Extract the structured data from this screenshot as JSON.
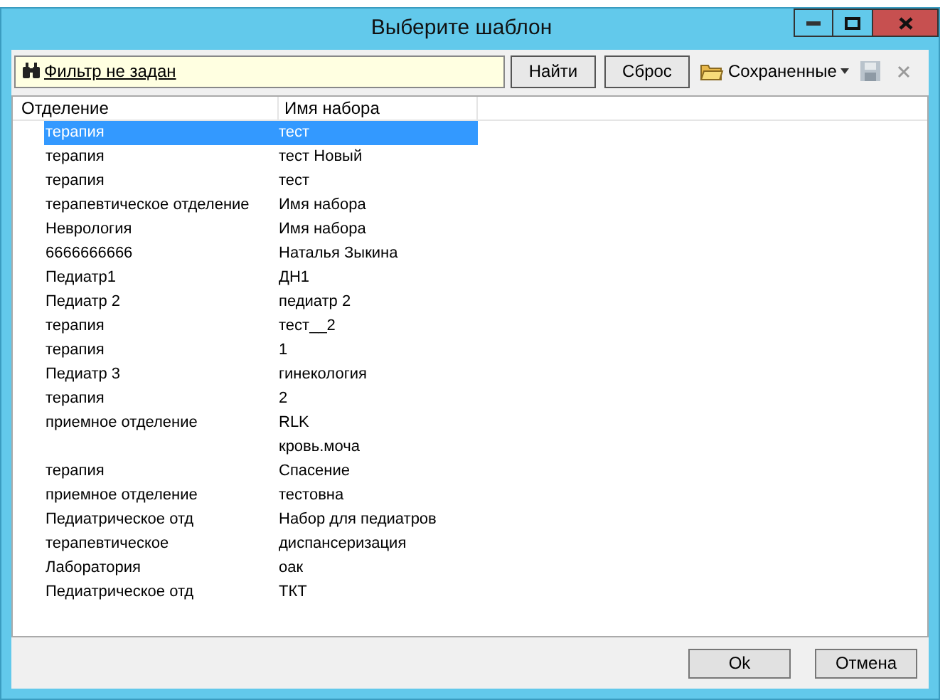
{
  "window": {
    "title": "Выберите шаблон"
  },
  "toolbar": {
    "filter": "Фильтр не задан",
    "find_button": "Найти",
    "reset_button": "Сброс",
    "saved_menu": "Сохраненные"
  },
  "table": {
    "columns": [
      "Отделение",
      "Имя набора"
    ],
    "rows": [
      {
        "department": "терапия",
        "set_name": "тест",
        "selected": true
      },
      {
        "department": "терапия",
        "set_name": "тест Новый",
        "selected": false
      },
      {
        "department": "терапия",
        "set_name": "тест",
        "selected": false
      },
      {
        "department": "терапевтическое отделение",
        "set_name": "Имя набора",
        "selected": false
      },
      {
        "department": "Неврология",
        "set_name": "Имя набора",
        "selected": false
      },
      {
        "department": "6666666666",
        "set_name": "Наталья Зыкина",
        "selected": false
      },
      {
        "department": "Педиатр1",
        "set_name": "ДН1",
        "selected": false
      },
      {
        "department": "Педиатр 2",
        "set_name": "педиатр 2",
        "selected": false
      },
      {
        "department": "терапия",
        "set_name": "тест__2",
        "selected": false
      },
      {
        "department": "терапия",
        "set_name": "1",
        "selected": false
      },
      {
        "department": "Педиатр 3",
        "set_name": "гинекология",
        "selected": false
      },
      {
        "department": "терапия",
        "set_name": "2",
        "selected": false
      },
      {
        "department": "приемное отделение",
        "set_name": "RLK",
        "selected": false
      },
      {
        "set_name": "кровь.моча",
        "selected": false
      },
      {
        "department": "терапия",
        "set_name": "Спасение",
        "selected": false
      },
      {
        "department": "приемное отделение",
        "set_name": "тестовна",
        "selected": false
      },
      {
        "department": "Педиатрическое отд",
        "set_name": "Набор для педиатров",
        "selected": false
      },
      {
        "department": "терапевтическое",
        "set_name": "диспансеризация",
        "selected": false
      },
      {
        "department": "Лаборатория",
        "set_name": "оак",
        "selected": false
      },
      {
        "department": "Педиатрическое отд",
        "set_name": "ТКТ",
        "selected": false
      }
    ]
  },
  "buttons": [
    "Ok",
    "Отмена"
  ]
}
